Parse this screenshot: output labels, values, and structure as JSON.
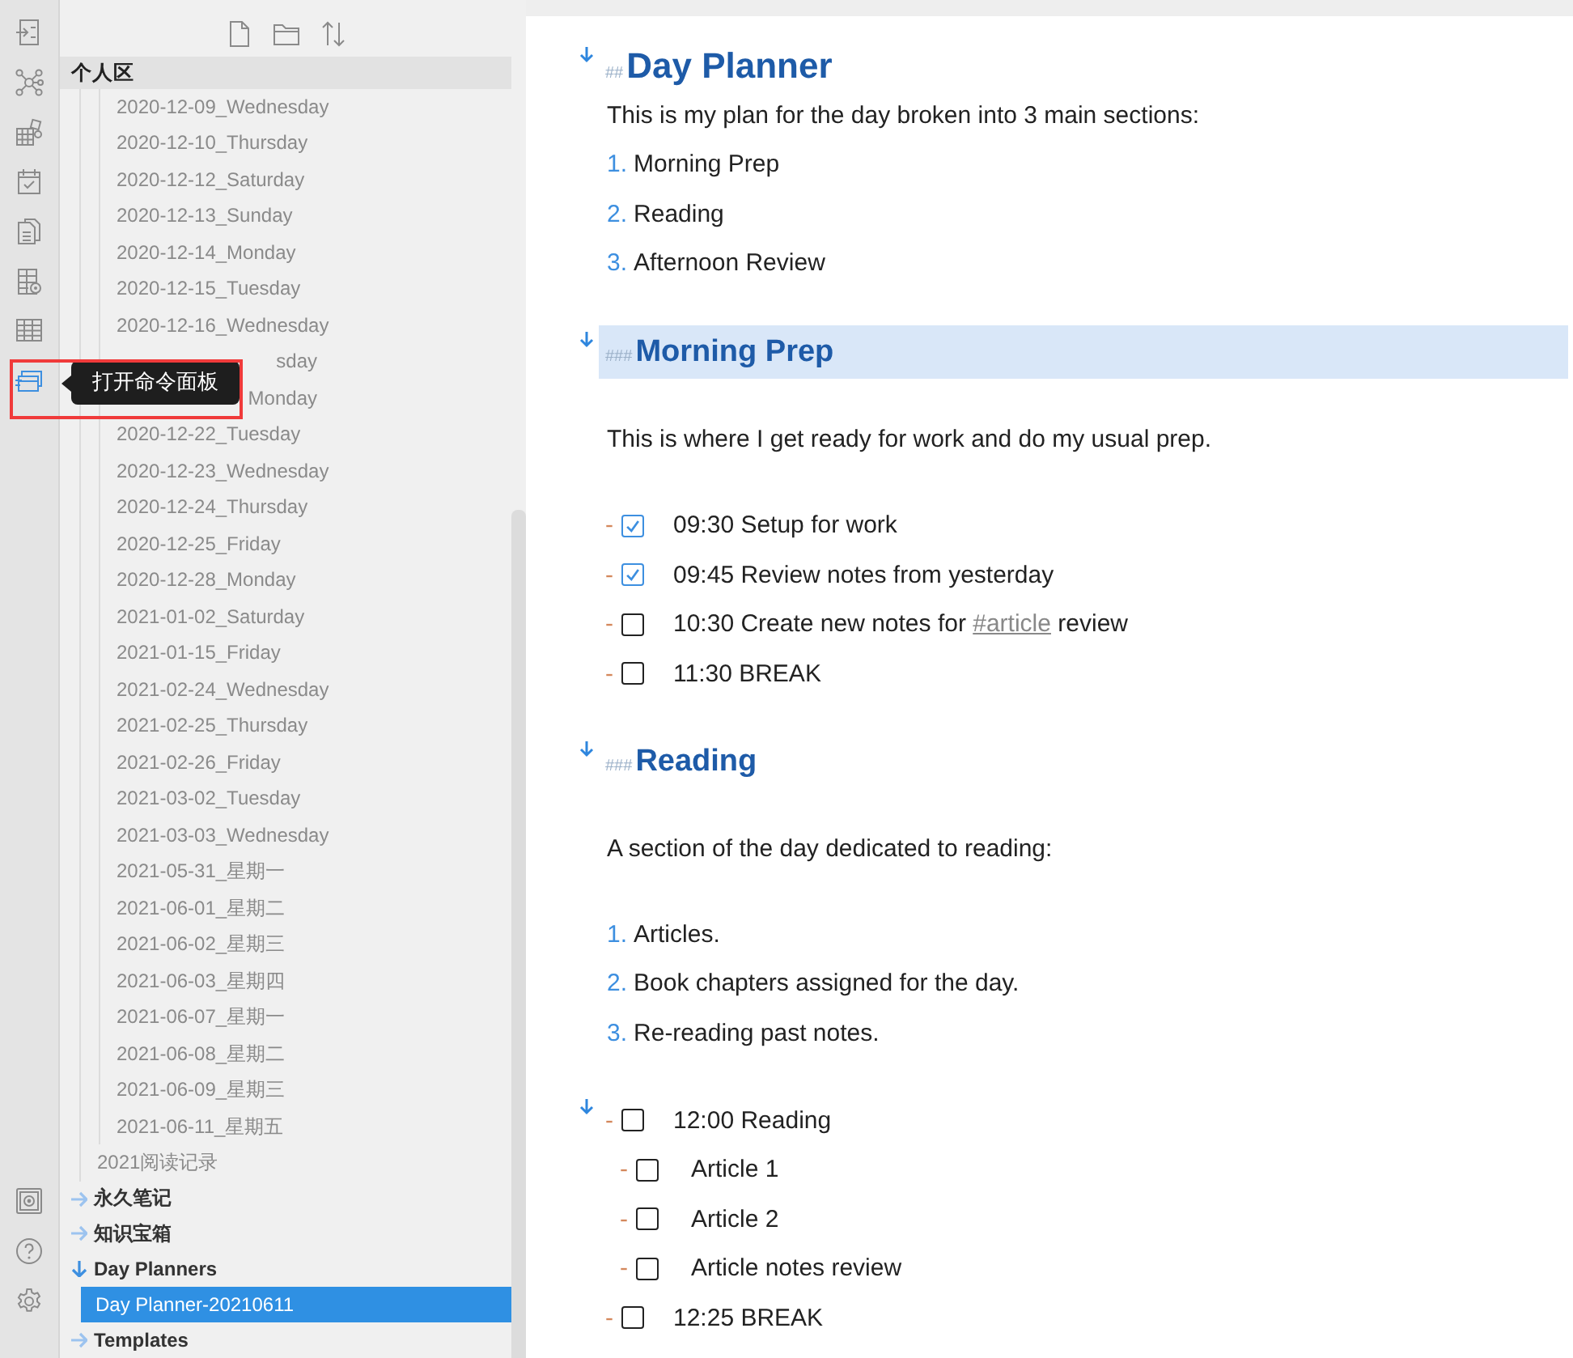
{
  "ribbon_icons": [
    {
      "active": false
    },
    {
      "active": false
    },
    {
      "active": false
    },
    {
      "active": false
    },
    {
      "active": false
    },
    {
      "active": false
    },
    {
      "active": false
    },
    {
      "active": true
    }
  ],
  "tooltip": {
    "text": "打开命令面板"
  },
  "explorer": {
    "pinned_folder": "个人区",
    "continued_tree": [
      {
        "children": [
          {
            "label": "2020-12-09_Wednesday"
          },
          {
            "label": "2020-12-10_Thursday"
          },
          {
            "label": "2020-12-12_Saturday"
          },
          {
            "label": "2020-12-13_Sunday"
          },
          {
            "label": "2020-12-14_Monday"
          },
          {
            "label": "2020-12-15_Tuesday"
          },
          {
            "label": "2020-12-16_Wednesday"
          },
          {
            "label": "sday",
            "kind": "partial"
          },
          {
            "label": "Monday",
            "kind": "partial"
          },
          {
            "label": "2020-12-22_Tuesday"
          },
          {
            "label": "2020-12-23_Wednesday"
          },
          {
            "label": "2020-12-24_Thursday"
          },
          {
            "label": "2020-12-25_Friday"
          },
          {
            "label": "2020-12-28_Monday"
          },
          {
            "label": "2021-01-02_Saturday"
          },
          {
            "label": "2021-01-15_Friday"
          },
          {
            "label": "2021-02-24_Wednesday"
          },
          {
            "label": "2021-02-25_Thursday"
          },
          {
            "label": "2021-02-26_Friday"
          },
          {
            "label": "2021-03-02_Tuesday"
          },
          {
            "label": "2021-03-03_Wednesday"
          },
          {
            "label": "2021-05-31_星期一"
          },
          {
            "label": "2021-06-01_星期二"
          },
          {
            "label": "2021-06-02_星期三"
          },
          {
            "label": "2021-06-03_星期四"
          },
          {
            "label": "2021-06-07_星期一"
          },
          {
            "label": "2021-06-08_星期二"
          },
          {
            "label": "2021-06-09_星期三"
          },
          {
            "label": "2021-06-11_星期五"
          }
        ]
      },
      {
        "label": "2021阅读记录"
      }
    ],
    "folders": [
      {
        "label": "永久笔记",
        "expanded": false
      },
      {
        "label": "知识宝箱",
        "expanded": false
      },
      {
        "label": "Day Planners",
        "expanded": true,
        "children": [
          {
            "label": "Day Planner-20210611",
            "selected": true
          }
        ]
      },
      {
        "label": "Templates",
        "expanded": false
      }
    ]
  },
  "document": {
    "blocks": [
      {
        "kind": "heading2",
        "marker": "##",
        "text": "Day Planner",
        "collapsible": true,
        "highlighted": false
      },
      {
        "kind": "paragraph",
        "text": "This is my plan for the day broken into 3 main sections:"
      },
      {
        "kind": "numbered",
        "items": [
          {
            "number": "1.",
            "text": "Morning Prep"
          },
          {
            "number": "2.",
            "text": "Reading"
          },
          {
            "number": "3.",
            "text": "Afternoon Review"
          }
        ]
      },
      {
        "kind": "heading3",
        "marker": "###",
        "text": "Morning Prep",
        "collapsible": true,
        "highlighted": true
      },
      {
        "kind": "paragraph",
        "text": "This is where I get ready for work and do my usual prep."
      },
      {
        "kind": "tasks",
        "items": [
          {
            "bullet": "-",
            "checked": true,
            "text": "09:30 Setup for work"
          },
          {
            "bullet": "-",
            "checked": true,
            "text": "09:45 Review notes from yesterday"
          },
          {
            "bullet": "-",
            "checked": false,
            "text": "10:30 Create new notes for ",
            "tag": "#article",
            "text_after": " review"
          },
          {
            "bullet": "-",
            "checked": false,
            "text": "11:30 BREAK"
          }
        ]
      },
      {
        "kind": "heading3",
        "marker": "###",
        "text": "Reading",
        "collapsible": true,
        "highlighted": false
      },
      {
        "kind": "paragraph",
        "text": "A section of the day dedicated to reading:"
      },
      {
        "kind": "numbered",
        "items": [
          {
            "number": "1.",
            "text": "Articles."
          },
          {
            "number": "2.",
            "text": "Book chapters assigned for the day."
          },
          {
            "number": "3.",
            "text": "Re-reading past notes."
          }
        ]
      },
      {
        "kind": "tasks",
        "items": [
          {
            "bullet": "-",
            "checked": false,
            "text": "12:00 Reading",
            "collapsible": true,
            "children": [
              {
                "bullet": "-",
                "checked": false,
                "text": "Article 1"
              },
              {
                "bullet": "-",
                "checked": false,
                "text": "Article 2"
              },
              {
                "bullet": "-",
                "checked": false,
                "text": "Article notes review"
              }
            ]
          },
          {
            "bullet": "-",
            "checked": false,
            "text": "12:25 BREAK"
          }
        ]
      }
    ]
  }
}
